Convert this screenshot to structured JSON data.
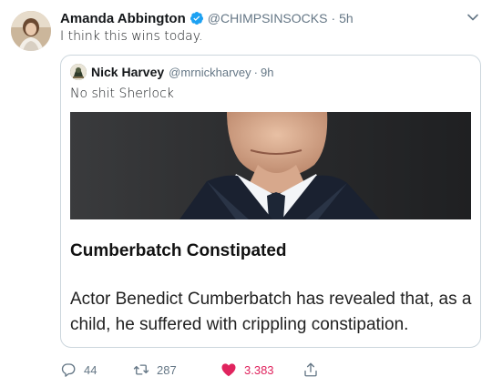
{
  "tweet": {
    "display_name": "Amanda Abbington",
    "handle": "@CHIMPSINSOCKS",
    "separator": "·",
    "time": "5h",
    "text": "I think this wins today."
  },
  "quoted": {
    "display_name": "Nick Harvey",
    "handle": "@mrnickharvey",
    "separator": "·",
    "time": "9h",
    "text": "No shit Sherlock",
    "headline": "Cumberbatch Constipated",
    "standfirst": "Actor Benedict Cumberbatch has revealed that, as a child, he suffered with crippling constipation."
  },
  "actions": {
    "replies": "44",
    "retweets": "287",
    "likes": "3.383"
  },
  "icons": {
    "verified": "verified-badge-icon",
    "menu": "chevron-down-icon",
    "reply": "reply-icon",
    "retweet": "retweet-icon",
    "like": "heart-icon",
    "share": "share-icon"
  },
  "colors": {
    "brand": "#1da1f2",
    "like": "#e0245e",
    "muted": "#657786",
    "border": "#ccd6dd"
  }
}
